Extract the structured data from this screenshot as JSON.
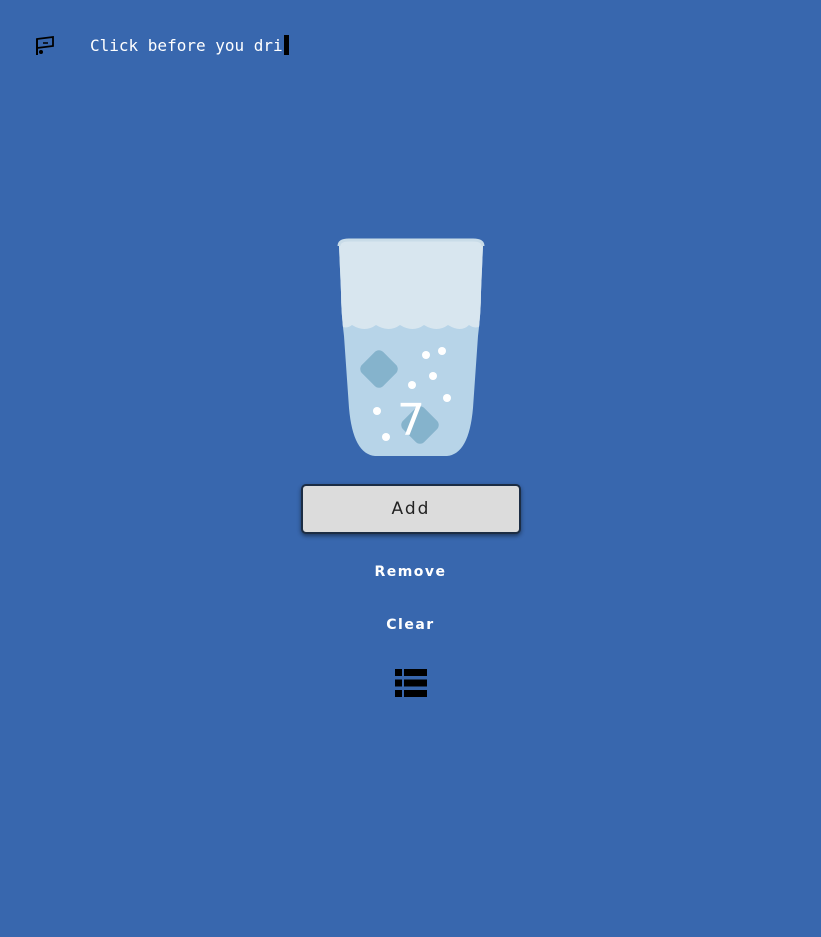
{
  "header": {
    "logo_icon": "flag-icon",
    "typed_text": "Click before you dri"
  },
  "glass": {
    "count": "7",
    "fill_level": 0.6,
    "colors": {
      "background": "#3867ae",
      "glass_empty": "#d8e6ef",
      "water": "#b7d4e8",
      "ice": "#85b3cc",
      "bubbles": "#ffffff"
    }
  },
  "controls": {
    "add_label": "Add",
    "remove_label": "Remove",
    "clear_label": "Clear",
    "list_icon": "list-icon"
  }
}
